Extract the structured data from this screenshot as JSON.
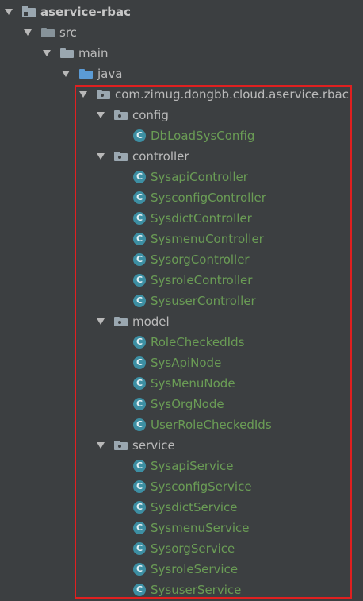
{
  "tree": {
    "module": "aservice-rbac",
    "src": "src",
    "main": "main",
    "java": "java",
    "package": "com.zimug.dongbb.cloud.aservice.rbac",
    "class_icon_letter": "C",
    "config": {
      "label": "config",
      "classes": [
        "DbLoadSysConfig"
      ]
    },
    "controller": {
      "label": "controller",
      "classes": [
        "SysapiController",
        "SysconfigController",
        "SysdictController",
        "SysmenuController",
        "SysorgController",
        "SysroleController",
        "SysuserController"
      ]
    },
    "model": {
      "label": "model",
      "classes": [
        "RoleCheckedIds",
        "SysApiNode",
        "SysMenuNode",
        "SysOrgNode",
        "UserRoleCheckedIds"
      ]
    },
    "service": {
      "label": "service",
      "classes": [
        "SysapiService",
        "SysconfigService",
        "SysdictService",
        "SysmenuService",
        "SysorgService",
        "SysroleService",
        "SysuserService"
      ]
    }
  },
  "colors": {
    "background": "#3c3f41",
    "text": "#bbbbbb",
    "class_text": "#6a9c55",
    "class_icon": "#3d8fa3",
    "highlight_border": "#e02020"
  }
}
